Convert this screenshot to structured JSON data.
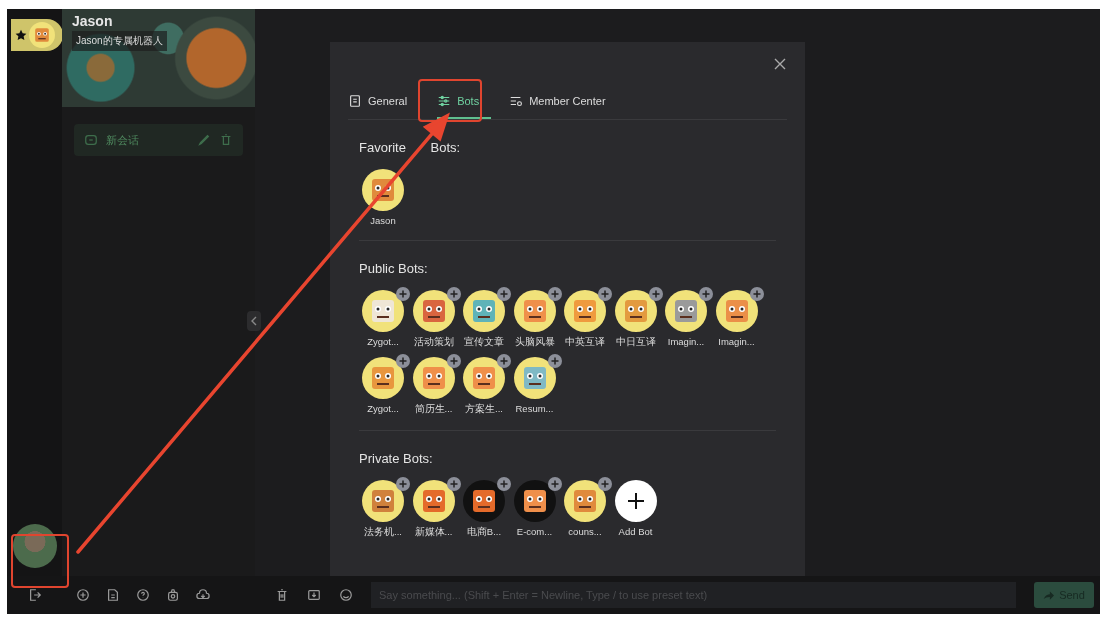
{
  "sidebar_header": {
    "favorite": true,
    "bot_name": "Jason",
    "bot_description": "Jason的专属机器人"
  },
  "conversations": [
    {
      "title": "新会话",
      "selected": true
    }
  ],
  "modal": {
    "tabs": [
      {
        "label": "General",
        "kind": "general",
        "selected": false
      },
      {
        "label": "Bots",
        "kind": "bots",
        "selected": true
      },
      {
        "label": "Member Center",
        "kind": "member",
        "selected": false
      }
    ],
    "sections": [
      {
        "title": "Favorite Bots:",
        "bots": [
          {
            "name": "Jason",
            "addable": false
          }
        ]
      },
      {
        "title": "Public Bots:",
        "bots": [
          {
            "name": "Zygot...",
            "addable": true
          },
          {
            "name": "活动策划",
            "addable": true
          },
          {
            "name": "宣传文章",
            "addable": true
          },
          {
            "name": "头脑风暴",
            "addable": true
          },
          {
            "name": "中英互译",
            "addable": true
          },
          {
            "name": "中日互译",
            "addable": true
          },
          {
            "name": "Imagin...",
            "addable": true
          },
          {
            "name": "Imagin...",
            "addable": true
          },
          {
            "name": "Zygot...",
            "addable": true
          },
          {
            "name": "简历生...",
            "addable": true
          },
          {
            "name": "方案生...",
            "addable": true
          },
          {
            "name": "Resum...",
            "addable": true
          }
        ]
      },
      {
        "title": "Private Bots:",
        "bots": [
          {
            "name": "法务机...",
            "addable": true
          },
          {
            "name": "新媒体...",
            "addable": true
          },
          {
            "name": "电商B...",
            "addable": true
          },
          {
            "name": "E-com...",
            "addable": true
          },
          {
            "name": "couns...",
            "addable": true
          }
        ],
        "add_label": "Add Bot"
      }
    ]
  },
  "input": {
    "placeholder": "Say something... (Shift + Enter = Newline, Type / to use preset text)"
  },
  "send_button": "Send"
}
